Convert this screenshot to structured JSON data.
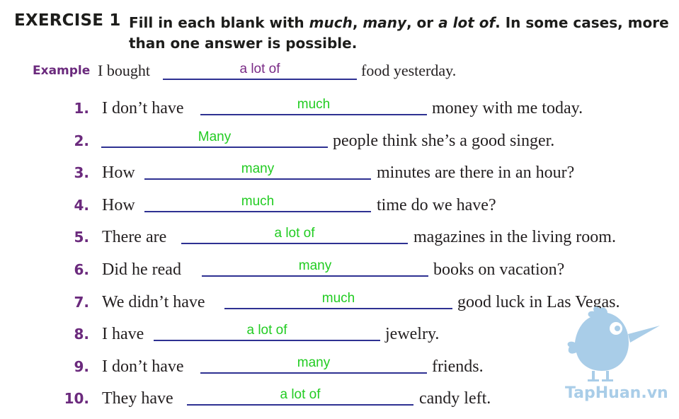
{
  "header": {
    "title": "EXERCISE 1",
    "instruction_parts": [
      "Fill in each blank with ",
      "much",
      ", ",
      "many",
      ", or ",
      "a lot of",
      ". In some cases, more than one answer is possible."
    ]
  },
  "example": {
    "label": "Example",
    "before": "I bought",
    "answer": "a lot of",
    "after": "food yesterday."
  },
  "items": [
    {
      "num": "1.",
      "before": "I don’t have",
      "answer": "much",
      "after": "money with me today."
    },
    {
      "num": "2.",
      "before": "",
      "answer": "Many",
      "after": "people think she’s a good singer."
    },
    {
      "num": "3.",
      "before": "How",
      "answer": "many",
      "after": "minutes are there in an hour?"
    },
    {
      "num": "4.",
      "before": "How",
      "answer": "much",
      "after": "time do we have?"
    },
    {
      "num": "5.",
      "before": "There are",
      "answer": "a lot of",
      "after": "magazines in the living room."
    },
    {
      "num": "6.",
      "before": "Did he read",
      "answer": "many",
      "after": "books on vacation?"
    },
    {
      "num": "7.",
      "before": "We didn’t have",
      "answer": "much",
      "after": "good luck in Las Vegas."
    },
    {
      "num": "8.",
      "before": "I have",
      "answer": "a lot of",
      "after": "jewelry."
    },
    {
      "num": "9.",
      "before": "I don’t have",
      "answer": "many",
      "after": "friends."
    },
    {
      "num": "10.",
      "before": "They have",
      "answer": "a lot of",
      "after": "candy left."
    }
  ],
  "watermark": {
    "text": "TapHuan.vn",
    "icon": "bird-mascot-icon",
    "color": "#a9cde8"
  },
  "colors": {
    "number": "#6b2a7d",
    "answer": "#22cc22",
    "example_answer": "#7a2b86",
    "blank_line": "#2e3192"
  }
}
